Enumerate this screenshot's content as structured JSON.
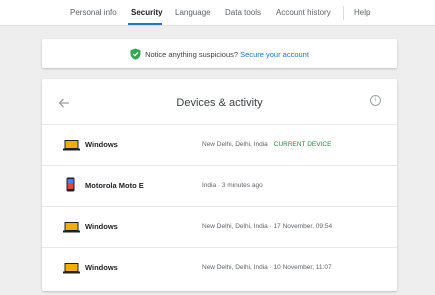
{
  "nav": {
    "tabs": [
      {
        "label": "Personal info",
        "active": false
      },
      {
        "label": "Security",
        "active": true
      },
      {
        "label": "Language",
        "active": false
      },
      {
        "label": "Data tools",
        "active": false
      },
      {
        "label": "Account history",
        "active": false
      },
      {
        "label": "Help",
        "active": false
      }
    ]
  },
  "alert": {
    "text": "Notice anything suspicious?",
    "link": "Secure your account",
    "icon": "shield-check-icon",
    "icon_color": "#34a853"
  },
  "devices": {
    "title": "Devices & activity",
    "items": [
      {
        "name": "Windows",
        "icon": "laptop-icon",
        "location": "New Delhi, Delhi, India",
        "status": "CURRENT DEVICE"
      },
      {
        "name": "Motorola Moto E",
        "icon": "phone-icon",
        "location": "India · 3 minutes ago",
        "status": ""
      },
      {
        "name": "Windows",
        "icon": "laptop-icon",
        "location": "New Delhi, Delhi, India · 17 November, 09:54",
        "status": ""
      },
      {
        "name": "Windows",
        "icon": "laptop-icon",
        "location": "New Delhi, Delhi, India · 10 November, 11:07",
        "status": ""
      }
    ]
  },
  "colors": {
    "accent": "#1a73e8",
    "current_device": "#1e8e3e",
    "background": "#eeeeee"
  }
}
